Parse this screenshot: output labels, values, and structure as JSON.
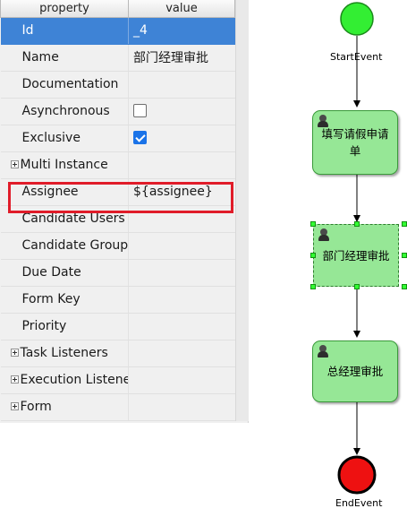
{
  "property_panel": {
    "header": {
      "property": "property",
      "value": "value"
    },
    "rows": [
      {
        "property": "Id",
        "value": "_4",
        "selected": true
      },
      {
        "property": "Name",
        "value": "部门经理审批"
      },
      {
        "property": "Documentation",
        "value": ""
      },
      {
        "property": "Asynchronous",
        "checkbox": false
      },
      {
        "property": "Exclusive",
        "checkbox": true
      },
      {
        "property": "Multi Instance",
        "group": true
      },
      {
        "property": "Assignee",
        "value": "${assignee}",
        "highlighted": true
      },
      {
        "property": "Candidate Users",
        "value": ""
      },
      {
        "property": "Candidate Groups",
        "value": ""
      },
      {
        "property": "Due Date",
        "value": ""
      },
      {
        "property": "Form Key",
        "value": ""
      },
      {
        "property": "Priority",
        "value": ""
      },
      {
        "property": "Task Listeners",
        "group": true
      },
      {
        "property": "Execution Listeners",
        "group": true
      },
      {
        "property": "Form",
        "group": true
      }
    ],
    "highlight_color": "#e01c29",
    "selection_color": "#3e83d6"
  },
  "workflow": {
    "start_event": {
      "label": "StartEvent",
      "color": "#33ee33"
    },
    "tasks": [
      {
        "label": "填写请假申请单",
        "selected": false
      },
      {
        "label": "部门经理审批",
        "selected": true
      },
      {
        "label": "总经理审批",
        "selected": false
      }
    ],
    "end_event": {
      "label": "EndEvent",
      "color": "#ee1111"
    },
    "task_color": "#96e796"
  }
}
